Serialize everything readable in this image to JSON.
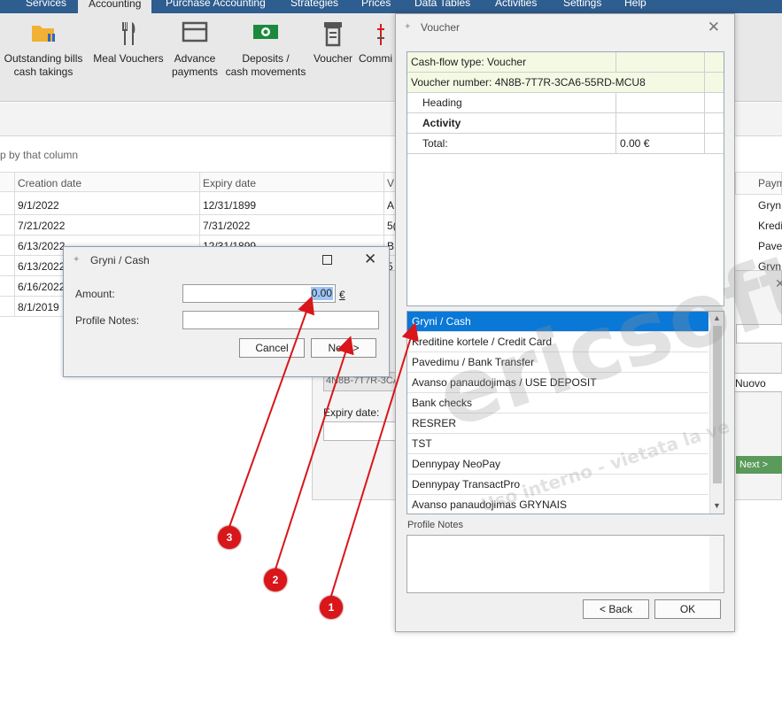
{
  "menu": {
    "items": [
      "Services",
      "Accounting",
      "Purchase Accounting",
      "Strategies",
      "Prices",
      "Data Tables",
      "Activities",
      "Settings",
      "Help"
    ],
    "active": "Accounting"
  },
  "ribbon": {
    "buttons": [
      {
        "line1": "Outstanding bills",
        "line2": "cash takings",
        "icon": "folder-icon"
      },
      {
        "line1": "Meal Vouchers",
        "line2": "",
        "icon": "fork-knife-icon"
      },
      {
        "line1": "Advance",
        "line2": "payments",
        "icon": "wallet-icon"
      },
      {
        "line1": "Deposits /",
        "line2": "cash movements",
        "icon": "banknote-icon"
      },
      {
        "line1": "Voucher",
        "line2": "",
        "icon": "voucher-icon"
      },
      {
        "line1": "Commi",
        "line2": "",
        "icon": "commission-icon"
      }
    ]
  },
  "grid": {
    "group_hint": "p by that column",
    "columns": [
      "Creation date",
      "Expiry date",
      "V"
    ],
    "rows": [
      {
        "created": "9/1/2022",
        "expiry": "12/31/1899",
        "v": "A"
      },
      {
        "created": "7/21/2022",
        "expiry": "7/31/2022",
        "v": "5("
      },
      {
        "created": "6/13/2022",
        "expiry": "12/31/1899",
        "v": "B"
      },
      {
        "created": "6/13/2022",
        "expiry": "",
        "v": "5"
      },
      {
        "created": "6/16/2022",
        "expiry": "",
        "v": ""
      },
      {
        "created": "8/1/2019",
        "expiry": "",
        "v": ""
      }
    ],
    "right_column": {
      "header": "Paym",
      "cells": [
        "Gryn",
        "Kredi",
        "Pave",
        "Gryn"
      ]
    }
  },
  "behind_dialog": {
    "code_fragment": "4N8B-7T7R-3CA",
    "expiry_label": "Expiry date:",
    "status": "Nuovo",
    "next_label": "Next >"
  },
  "voucher": {
    "title": "Voucher",
    "rows": [
      {
        "label": "Cash-flow type: Voucher",
        "value": "",
        "bold": false,
        "indent": false,
        "highlight": true
      },
      {
        "label": "Voucher number: 4N8B-7T7R-3CA6-55RD-MCU8",
        "value": "",
        "bold": false,
        "indent": false,
        "highlight": true
      },
      {
        "label": "Heading",
        "value": "",
        "bold": false,
        "indent": true,
        "highlight": false
      },
      {
        "label": "Activity",
        "value": "",
        "bold": true,
        "indent": true,
        "highlight": false
      },
      {
        "label": "Total:",
        "value": "0.00 €",
        "bold": false,
        "indent": true,
        "highlight": false
      }
    ],
    "payment_methods": [
      "Gryni / Cash",
      "Kreditine kortele / Credit Card",
      "Pavedimu / Bank Transfer",
      "Avanso panaudojimas / USE DEPOSIT",
      "Bank checks",
      "RESRER",
      "TST",
      "Dennypay NeoPay",
      "Dennypay TransactPro",
      "Avanso panaudojimas GRYNAIS"
    ],
    "selected_index": 0,
    "profile_notes_label": "Profile Notes",
    "back_label": "< Back",
    "ok_label": "OK"
  },
  "cash_dialog": {
    "title": "Gryni / Cash",
    "amount_label": "Amount:",
    "amount_value": "0.00",
    "currency": "€",
    "notes_label": "Profile Notes:",
    "cancel_label": "Cancel",
    "next_label": "Next >"
  },
  "watermark": {
    "big": "ericsoft",
    "small": "Uso interno - vietata la ve"
  },
  "annotations": {
    "badges": [
      "1",
      "2",
      "3"
    ],
    "color": "#d9161a"
  }
}
